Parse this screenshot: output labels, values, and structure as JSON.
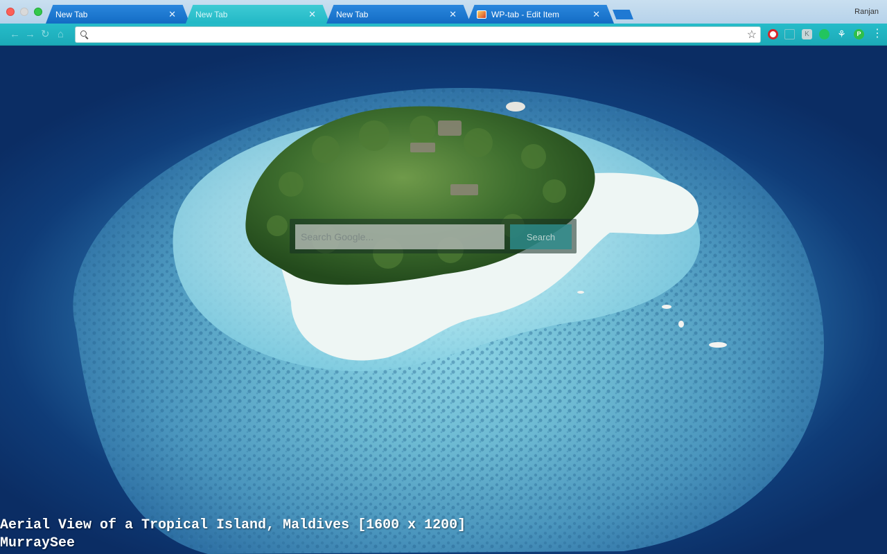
{
  "window": {
    "profile_name": "Ranjan"
  },
  "tabs": [
    {
      "label": "New Tab",
      "state": "inactive",
      "favicon": null
    },
    {
      "label": "New Tab",
      "state": "active",
      "favicon": null
    },
    {
      "label": "New Tab",
      "state": "inactive",
      "favicon": null
    },
    {
      "label": "WP-tab - Edit Item",
      "state": "inactive",
      "favicon": "wp-tab-icon"
    }
  ],
  "toolbar": {
    "address": {
      "value": "",
      "placeholder": ""
    },
    "nav_icons": [
      "back-arrow-icon",
      "forward-arrow-icon",
      "reload-icon",
      "home-icon"
    ],
    "extensions": [
      "opera-icon",
      "cast-icon",
      "keyboard-icon",
      "green-dot-icon",
      "tree-icon",
      "pushbullet-icon"
    ],
    "pb_glyph": "P",
    "kbd_glyph": "K"
  },
  "search": {
    "placeholder": "Search Google...",
    "button_label": "Search"
  },
  "caption": {
    "line1": "Aerial View of a Tropical Island, Maldives [1600 x 1200]",
    "line2": "MurraySee"
  },
  "colors": {
    "tab_active": "#22b8c6",
    "tab_inactive": "#136cc4",
    "toolbar": "#1caab8",
    "ocean_deep": "#0b2d64"
  }
}
